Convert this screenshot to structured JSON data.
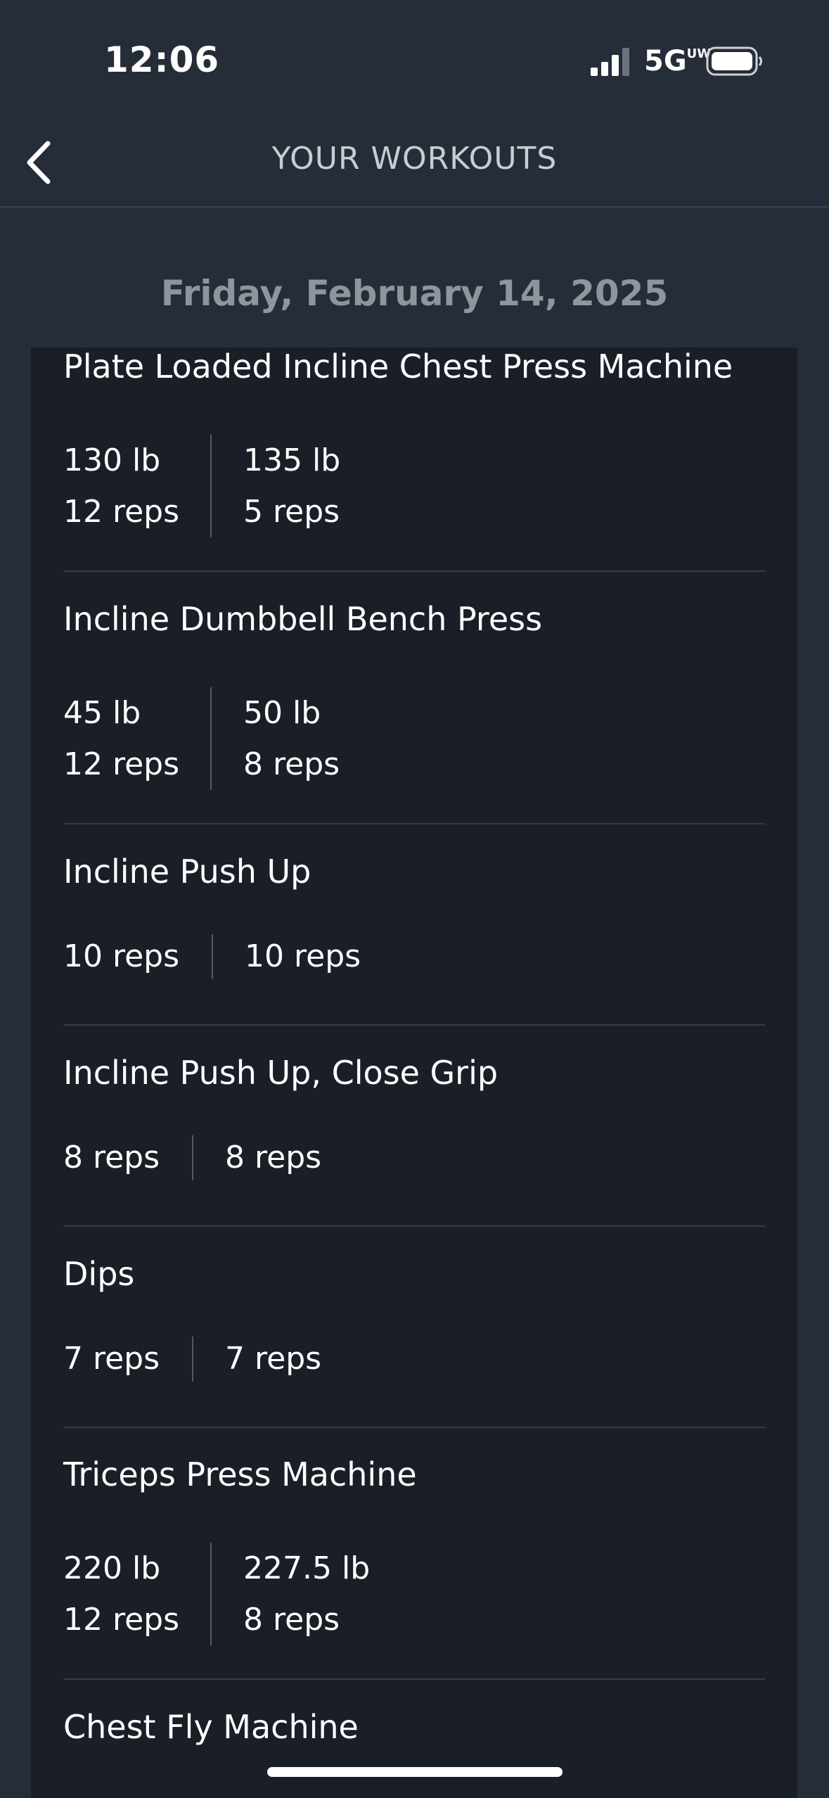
{
  "status_bar": {
    "time": "12:06",
    "network_main": "5G",
    "network_sup": "UW",
    "signal_icon": "signal-bars-icon",
    "battery_icon": "battery-icon"
  },
  "nav": {
    "back_icon": "chevron-left-icon",
    "title": "YOUR WORKOUTS"
  },
  "date": "Friday, February 14, 2025",
  "exercises": [
    {
      "name": "Plate Loaded Incline Chest Press Machine",
      "sets": [
        {
          "weight": "130 lb",
          "reps": "12 reps"
        },
        {
          "weight": "135 lb",
          "reps": "5 reps"
        }
      ]
    },
    {
      "name": "Incline Dumbbell Bench Press",
      "sets": [
        {
          "weight": "45 lb",
          "reps": "12 reps"
        },
        {
          "weight": "50 lb",
          "reps": "8 reps"
        }
      ]
    },
    {
      "name": "Incline Push Up",
      "sets": [
        {
          "reps": "10 reps"
        },
        {
          "reps": "10 reps"
        }
      ]
    },
    {
      "name": "Incline Push Up, Close Grip",
      "sets": [
        {
          "reps": "8 reps"
        },
        {
          "reps": "8 reps"
        }
      ]
    },
    {
      "name": "Dips",
      "sets": [
        {
          "reps": "7 reps"
        },
        {
          "reps": "7 reps"
        }
      ]
    },
    {
      "name": "Triceps Press Machine",
      "sets": [
        {
          "weight": "220 lb",
          "reps": "12 reps"
        },
        {
          "weight": "227.5 lb",
          "reps": "8 reps"
        }
      ]
    },
    {
      "name": "Chest Fly Machine",
      "sets": []
    }
  ]
}
